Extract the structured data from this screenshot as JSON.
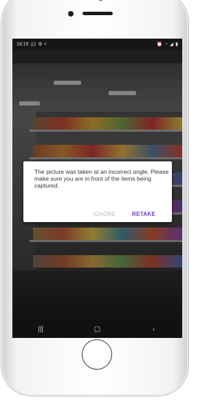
{
  "status_bar": {
    "time": "18:15",
    "left_icons": [
      "sim-icon",
      "wifi-icon",
      "dot"
    ],
    "right_icons": [
      "alarm-icon",
      "wifi-icon",
      "signal-icon",
      "battery-icon"
    ]
  },
  "dialog": {
    "message": "The picture was taken at an incorrect angle. Please make sure you are in front of the items being captured.",
    "ignore_label": "IGNORE",
    "retake_label": "RETAKE"
  },
  "nav_bar": {
    "recents": "|||",
    "home": "▢",
    "back": "‹"
  },
  "colors": {
    "accent": "#6f3cc4",
    "disabled": "#b8b8b8"
  }
}
